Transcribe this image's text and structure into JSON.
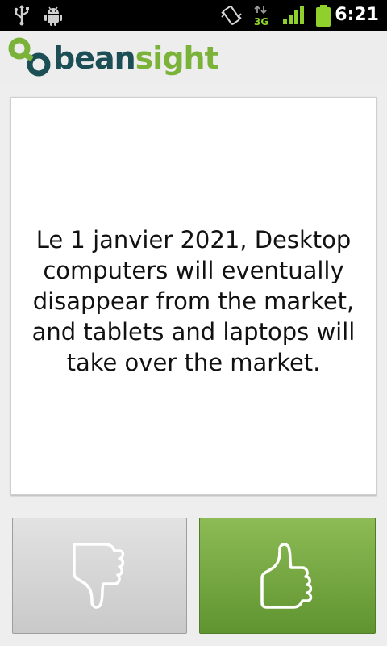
{
  "status_bar": {
    "time": "6:21",
    "network": "3G",
    "icons": [
      "usb-icon",
      "android-debug-icon",
      "vibrate-icon",
      "data-3g-icon",
      "signal-icon",
      "battery-icon"
    ]
  },
  "header": {
    "logo_bean": "bean",
    "logo_sight": "sight",
    "colors": {
      "bean": "#1c4f55",
      "sight": "#7bb23a"
    }
  },
  "prediction": {
    "text": "Le 1 janvier 2021, Desktop computers will eventually disappear from the market, and tablets and laptops  will take over the market."
  },
  "actions": {
    "disagree_icon": "thumbs-down-icon",
    "agree_icon": "thumbs-up-icon",
    "colors": {
      "agree": "#6fa23e",
      "disagree": "#d6d6d6"
    }
  }
}
